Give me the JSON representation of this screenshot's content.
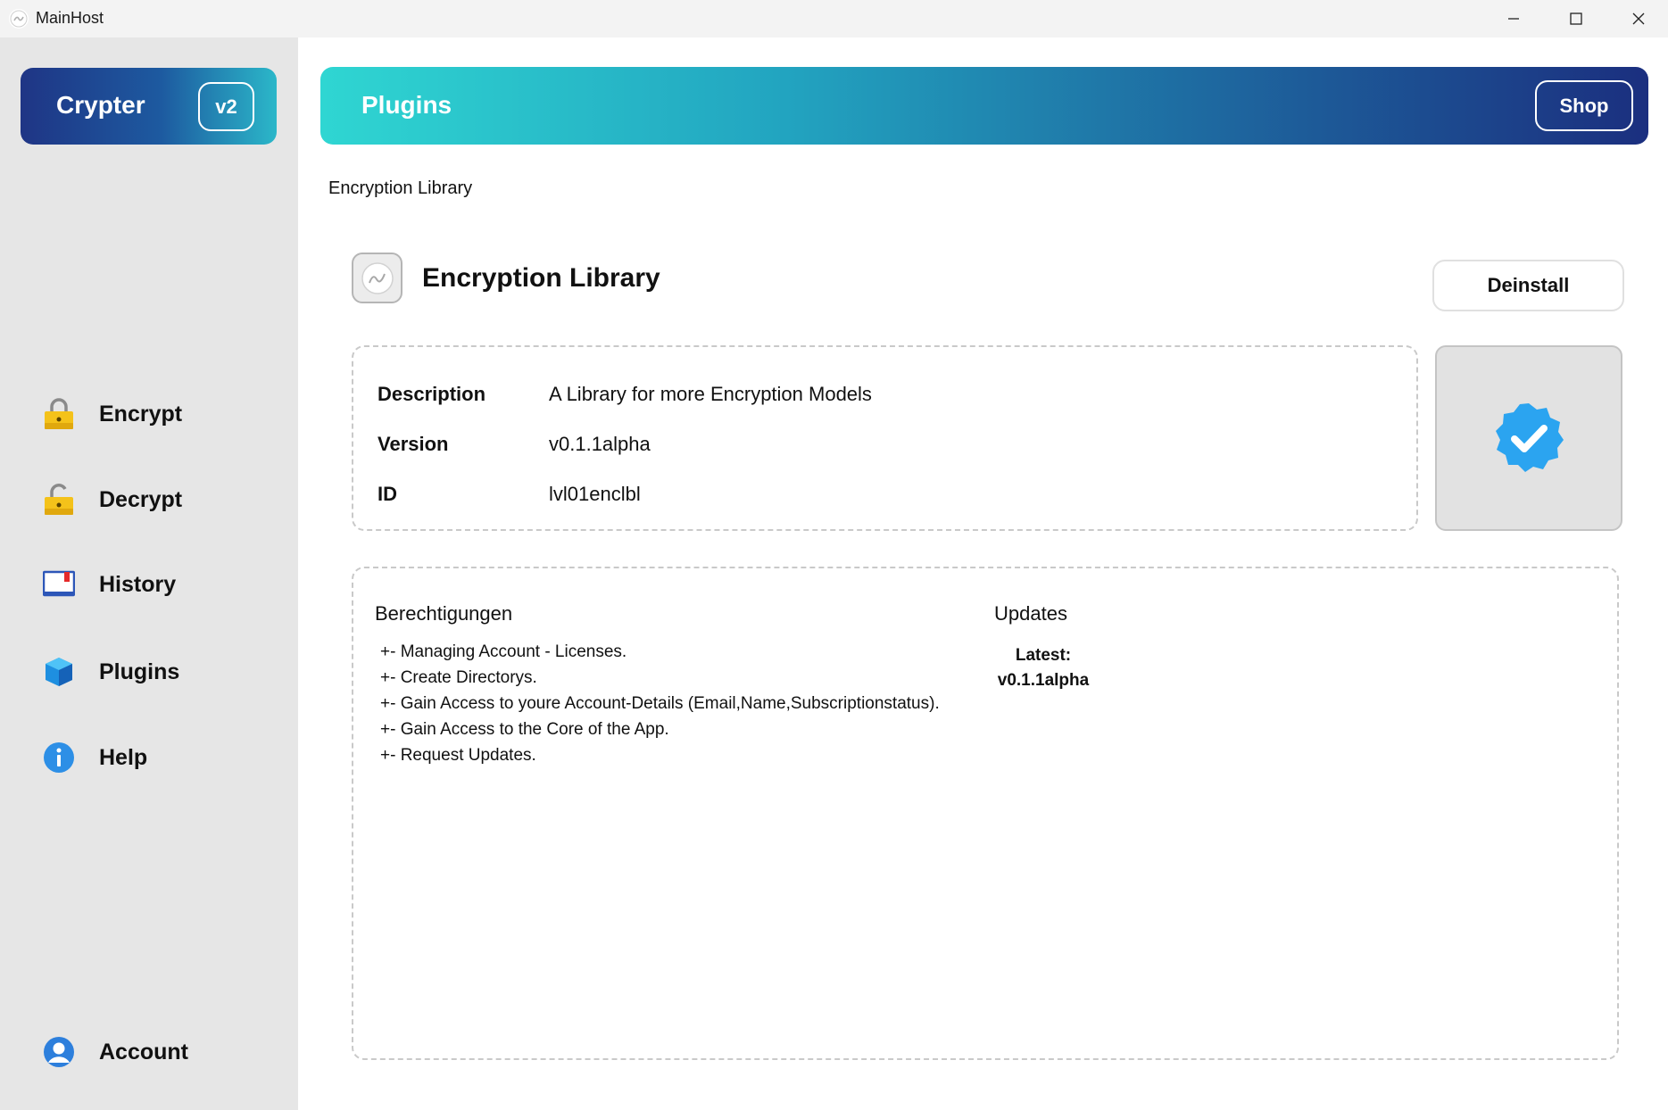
{
  "window": {
    "title": "MainHost",
    "controls": [
      "minimize-icon",
      "maximize-icon",
      "close-icon"
    ]
  },
  "sidebar": {
    "brand": {
      "name": "Crypter",
      "version": "v2"
    },
    "items": [
      {
        "label": "Encrypt",
        "icon": "lock-closed-icon"
      },
      {
        "label": "Decrypt",
        "icon": "lock-open-icon"
      },
      {
        "label": "History",
        "icon": "book-icon"
      },
      {
        "label": "Plugins",
        "icon": "cube-icon"
      },
      {
        "label": "Help",
        "icon": "info-icon"
      }
    ],
    "account": {
      "label": "Account",
      "icon": "user-icon"
    }
  },
  "header": {
    "title": "Plugins",
    "shop_label": "Shop"
  },
  "breadcrumb": "Encryption Library",
  "plugin": {
    "title": "Encryption Library",
    "deinstall_label": "Deinstall",
    "info": [
      {
        "key": "Description",
        "value": "A Library for more Encryption Models"
      },
      {
        "key": "Version",
        "value": "v0.1.1alpha"
      },
      {
        "key": "ID",
        "value": "lvl01enclbl"
      }
    ],
    "status_icon": "verified-check-icon"
  },
  "details": {
    "permissions_title": "Berechtigungen",
    "permissions": [
      "+- Managing Account - Licenses.",
      "+- Create Directorys.",
      "+- Gain Access to youre Account-Details (Email,Name,Subscriptionstatus).",
      "+- Gain Access to the Core of the App.",
      "+- Request Updates."
    ],
    "updates_title": "Updates",
    "latest_label": "Latest:",
    "latest_version": "v0.1.1alpha"
  },
  "colors": {
    "sidebar_bg": "#e6e6e6",
    "brand_gradient": [
      "#1f3585",
      "#2bb7c9"
    ],
    "header_gradient": [
      "#2fd6d2",
      "#1b2f7f"
    ],
    "verified_blue": "#2ba4f0"
  }
}
